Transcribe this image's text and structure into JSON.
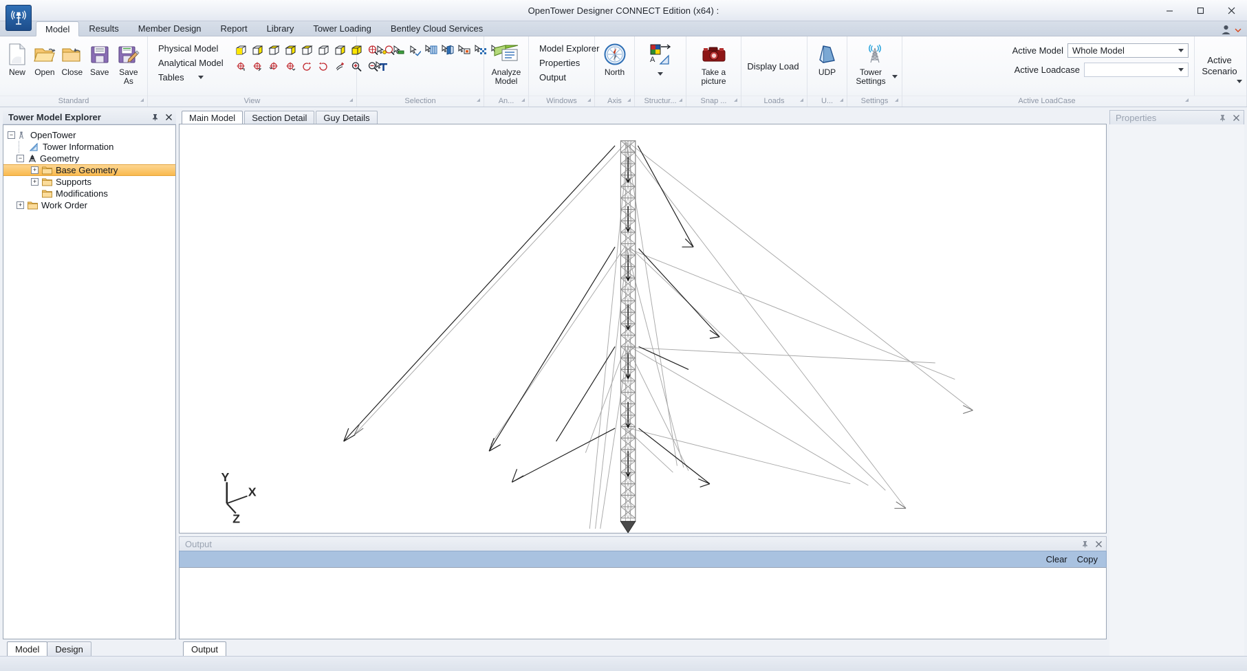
{
  "window": {
    "title": "OpenTower Designer CONNECT Edition (x64) :",
    "minimize_label": "Minimize",
    "maximize_label": "Maximize",
    "close_label": "Close",
    "app_icon": "tower-antenna-icon"
  },
  "ribbon_tabs": [
    {
      "label": "Model",
      "active": true
    },
    {
      "label": "Results",
      "active": false
    },
    {
      "label": "Member Design",
      "active": false
    },
    {
      "label": "Report",
      "active": false
    },
    {
      "label": "Library",
      "active": false
    },
    {
      "label": "Tower Loading",
      "active": false
    },
    {
      "label": "Bentley Cloud Services",
      "active": false
    }
  ],
  "ribbon": {
    "groups": [
      {
        "name": "standard",
        "label": "Standard",
        "buttons": [
          {
            "label": "New",
            "icon": "new-document-icon"
          },
          {
            "label": "Open",
            "icon": "open-folder-icon"
          },
          {
            "label": "Close",
            "icon": "close-folder-icon"
          },
          {
            "label": "Save",
            "icon": "floppy-save-icon"
          },
          {
            "label": "Save As",
            "icon": "floppy-save-as-icon"
          }
        ]
      },
      {
        "name": "view",
        "label": "View",
        "text_items": [
          {
            "label": "Physical Model",
            "caret": false
          },
          {
            "label": "Analytical Model",
            "caret": false
          },
          {
            "label": "Tables",
            "caret": true
          }
        ],
        "icons_row1": [
          "iso-view-icon",
          "front-view-icon",
          "top-view-icon",
          "side-view-icon",
          "back-view-icon",
          "bottom-view-icon",
          "left-view-icon",
          "solid-view-icon",
          "zoom-window-icon",
          "zoom-fit-icon"
        ],
        "icons_row2": [
          "pan-up-icon",
          "pan-down-icon",
          "pan-left-icon",
          "pan-right-icon",
          "rotate-ccw-icon",
          "rotate-cw-icon",
          "spin-left-icon",
          "spin-right-icon",
          "dynamic-rotate-icon",
          "zoom-in-icon",
          "zoom-out-icon"
        ]
      },
      {
        "name": "selection",
        "label": "Selection",
        "icons_row1": [
          "select-node-icon",
          "select-beam-icon",
          "select-plate-icon",
          "select-panel-icon",
          "select-surface-icon",
          "select-solid-icon",
          "select-mesh-icon",
          "select-all-icon"
        ],
        "icons_row2": [
          "select-text-icon"
        ]
      },
      {
        "name": "analysis",
        "label": "An...",
        "buttons": [
          {
            "label": "Analyze Model",
            "icon": "analyze-model-icon"
          }
        ]
      },
      {
        "name": "windows",
        "label": "Windows",
        "text_items": [
          {
            "label": "Model Explorer",
            "caret": false
          },
          {
            "label": "Properties",
            "caret": false
          },
          {
            "label": "Output",
            "caret": false
          }
        ]
      },
      {
        "name": "axis",
        "label": "Axis",
        "buttons": [
          {
            "label": "North",
            "icon": "compass-north-icon"
          }
        ]
      },
      {
        "name": "structure",
        "label": "Structur...",
        "buttons": [
          {
            "label": "",
            "icon": "structure-palette-icon",
            "caret": true
          }
        ]
      },
      {
        "name": "snap",
        "label": "Snap ...",
        "buttons": [
          {
            "label": "Take a picture",
            "icon": "camera-icon"
          }
        ]
      },
      {
        "name": "loads",
        "label": "Loads",
        "buttons": [
          {
            "label": "Display Load",
            "icon": "display-load-icon"
          }
        ]
      },
      {
        "name": "udp",
        "label": "U...",
        "buttons": [
          {
            "label": "UDP",
            "icon": "udp-frustum-icon"
          }
        ]
      },
      {
        "name": "settings",
        "label": "Settings",
        "buttons": [
          {
            "label": "Tower Settings",
            "icon": "tower-settings-icon",
            "caret": true
          }
        ]
      },
      {
        "name": "active_loadcase",
        "label": "Active LoadCase",
        "fields": [
          {
            "label": "Active Model",
            "value": "Whole Model",
            "name": "active-model-combo"
          },
          {
            "label": "Active Loadcase",
            "value": "",
            "name": "active-loadcase-combo"
          }
        ],
        "scenario_button": "Active Scenario"
      }
    ]
  },
  "explorer": {
    "title": "Tower Model Explorer",
    "pin_icon": "pin-icon",
    "close_icon": "close-icon",
    "tree": [
      {
        "label": "OpenTower",
        "depth": 0,
        "expander": "minus",
        "icon": "tower-icon",
        "selected": false
      },
      {
        "label": "Tower Information",
        "depth": 1,
        "expander": "none",
        "icon": "tower-info-icon",
        "selected": false
      },
      {
        "label": "Geometry",
        "depth": 1,
        "expander": "minus",
        "icon": "geometry-icon",
        "selected": false
      },
      {
        "label": "Base Geometry",
        "depth": 2,
        "expander": "plus",
        "icon": "folder-icon",
        "selected": true
      },
      {
        "label": "Supports",
        "depth": 2,
        "expander": "plus",
        "icon": "folder-icon",
        "selected": false
      },
      {
        "label": "Modifications",
        "depth": 2,
        "expander": "none",
        "icon": "folder-icon",
        "selected": false
      },
      {
        "label": "Work Order",
        "depth": 1,
        "expander": "plus",
        "icon": "folder-icon",
        "selected": false
      }
    ],
    "bottom_tabs": [
      {
        "label": "Model",
        "active": true
      },
      {
        "label": "Design",
        "active": false
      }
    ]
  },
  "view_tabs": [
    {
      "label": "Main Model",
      "active": true
    },
    {
      "label": "Section Detail",
      "active": false
    },
    {
      "label": "Guy Details",
      "active": false
    }
  ],
  "viewport": {
    "axis_x": "X",
    "axis_y": "Y",
    "axis_z": "Z",
    "model_description": "Guyed lattice tower with guy wires"
  },
  "output": {
    "title": "Output",
    "pin_icon": "pin-icon",
    "close_icon": "close-icon",
    "clear_label": "Clear",
    "copy_label": "Copy",
    "content": "",
    "tabs": [
      {
        "label": "Output",
        "active": true
      }
    ]
  },
  "properties": {
    "title": "Properties",
    "pin_icon": "pin-icon",
    "close_icon": "close-icon",
    "content": ""
  },
  "colors": {
    "accent": "#2f6fb5",
    "selection": "#f9b94e",
    "output_toolbar": "#a9c2e0",
    "ribbon_bg": "#f5f7fa",
    "tab_bg": "#ccd5e2"
  }
}
